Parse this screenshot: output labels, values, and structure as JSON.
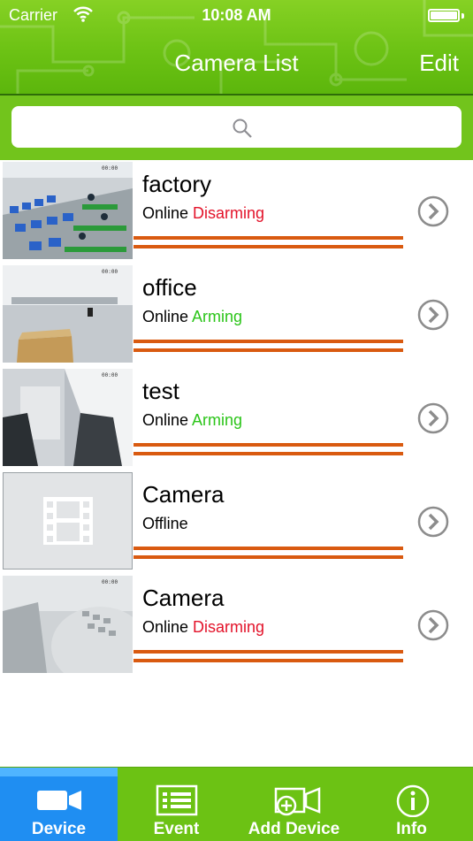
{
  "status_bar": {
    "carrier": "Carrier",
    "time": "10:08 AM"
  },
  "nav": {
    "title": "Camera List",
    "edit_label": "Edit"
  },
  "search": {
    "placeholder": ""
  },
  "cameras": [
    {
      "name": "factory",
      "connection": "Online",
      "state": "Disarming",
      "state_color": "#e3132a",
      "thumbnail": "factory-floor"
    },
    {
      "name": "office",
      "connection": "Online",
      "state": "Arming",
      "state_color": "#2cc51a",
      "thumbnail": "office-room"
    },
    {
      "name": "test",
      "connection": "Online",
      "state": "Arming",
      "state_color": "#2cc51a",
      "thumbnail": "test-room"
    },
    {
      "name": "Camera",
      "connection": "Offline",
      "state": "",
      "state_color": "#000000",
      "thumbnail": "film-placeholder-icon"
    },
    {
      "name": "Camera",
      "connection": "Online",
      "state": "Disarming",
      "state_color": "#e3132a",
      "thumbnail": "telephone-closeup"
    }
  ],
  "tabs": [
    {
      "label": "Device",
      "icon": "video-camera-icon",
      "active": true
    },
    {
      "label": "Event",
      "icon": "list-icon",
      "active": false
    },
    {
      "label": "Add Device",
      "icon": "add-camera-icon",
      "active": false
    },
    {
      "label": "Info",
      "icon": "info-icon",
      "active": false
    }
  ],
  "colors": {
    "header_green": "#6cc214",
    "tab_active_blue": "#1f8ef2",
    "redaction_orange": "#d95a10"
  }
}
